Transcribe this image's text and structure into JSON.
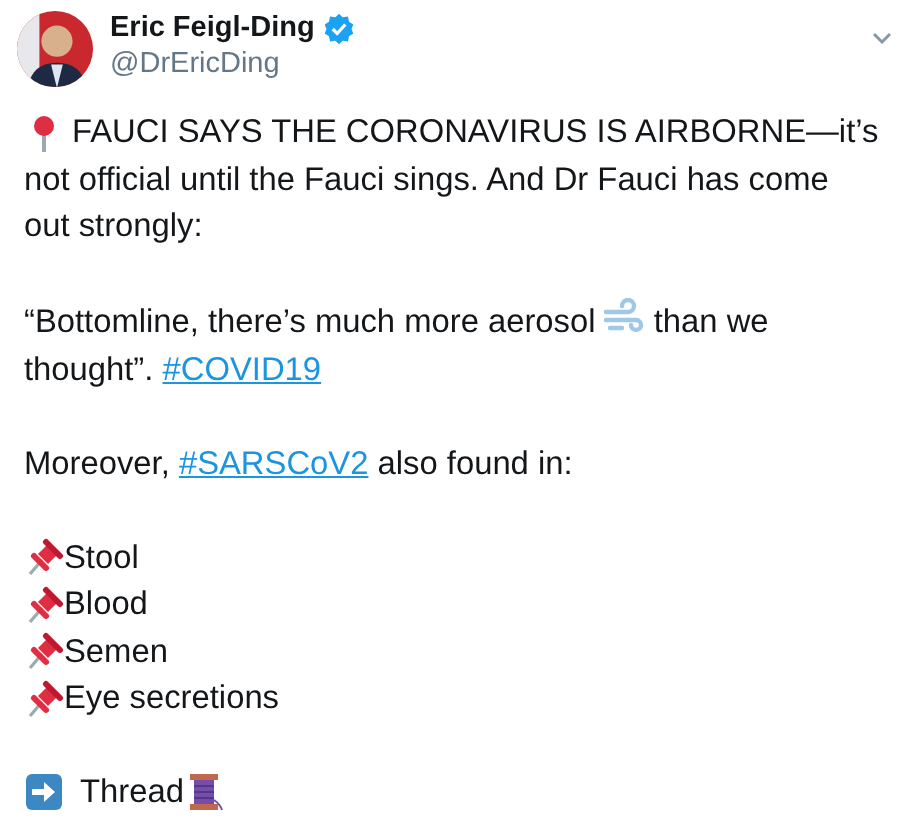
{
  "author": {
    "name": "Eric Feigl-Ding",
    "handle": "@DrEricDing",
    "verified": true
  },
  "lead_lines": [
    "FAUCI SAYS THE CORONAVIRUS IS AIRBORNE—it’s",
    "not official until the Fauci sings. And Dr Fauci has come out strongly:"
  ],
  "quote": {
    "before": "“Bottomline, there’s much more aerosol",
    "after": "than we",
    "continued": "thought”.",
    "hashtag": "#COVID19"
  },
  "moreover": {
    "before": "Moreover,",
    "hashtag": "#SARSCoV2",
    "after": "also found in:"
  },
  "found_in": [
    "Stool",
    "Blood",
    "Semen",
    "Eye secretions"
  ],
  "thread": "Thread"
}
